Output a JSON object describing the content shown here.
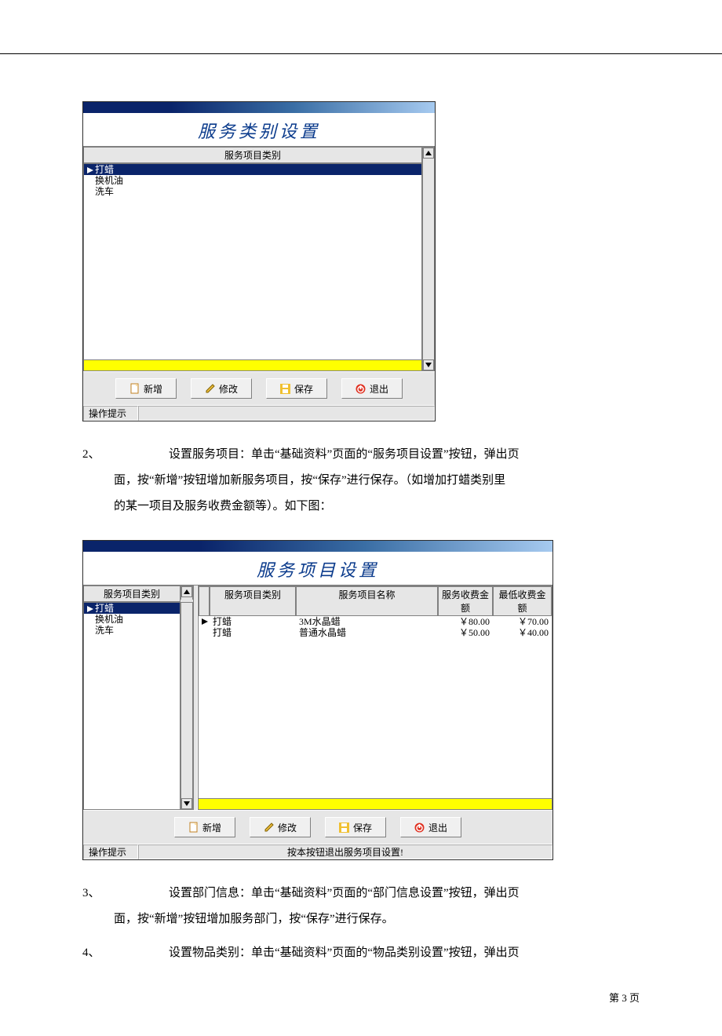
{
  "window1": {
    "title": "服务类别设置",
    "columnHeader": "服务项目类别",
    "items": [
      "打蜡",
      "换机油",
      "洗车"
    ],
    "buttons": {
      "add": "新增",
      "edit": "修改",
      "save": "保存",
      "exit": "退出"
    },
    "statusLabel": "操作提示"
  },
  "para2": {
    "num": "2、",
    "line1": "设置服务项目：单击“基础资料”页面的“服务项目设置”按钮，弹出页",
    "line2": "面，按“新增”按钮增加新服务项目，按“保存”进行保存。（如增加打蜡类别里",
    "line3": "的某一项目及服务收费金额等）。如下图："
  },
  "window2": {
    "title": "服务项目设置",
    "leftHeader": "服务项目类别",
    "leftItems": [
      "打蜡",
      "换机油",
      "洗车"
    ],
    "headers": {
      "cat": "服务项目类别",
      "name": "服务项目名称",
      "fee": "服务收费金额",
      "min": "最低收费金额"
    },
    "rows": [
      {
        "cat": "打蜡",
        "name": "3M水晶蜡",
        "fee": "￥80.00",
        "min": "￥70.00"
      },
      {
        "cat": "打蜡",
        "name": "普通水晶蜡",
        "fee": "￥50.00",
        "min": "￥40.00"
      }
    ],
    "buttons": {
      "add": "新增",
      "edit": "修改",
      "save": "保存",
      "exit": "退出"
    },
    "statusLabel": "操作提示",
    "statusMsg": "按本按钮退出服务项目设置!"
  },
  "para3": {
    "num": "3、",
    "line1": "设置部门信息：单击“基础资料”页面的“部门信息设置”按钮，弹出页",
    "line2": "面，按“新增”按钮增加服务部门，按“保存”进行保存。"
  },
  "para4": {
    "num": "4、",
    "line1": "设置物品类别：单击“基础资料”页面的“物品类别设置”按钮，弹出页"
  },
  "footer": "第 3 页"
}
